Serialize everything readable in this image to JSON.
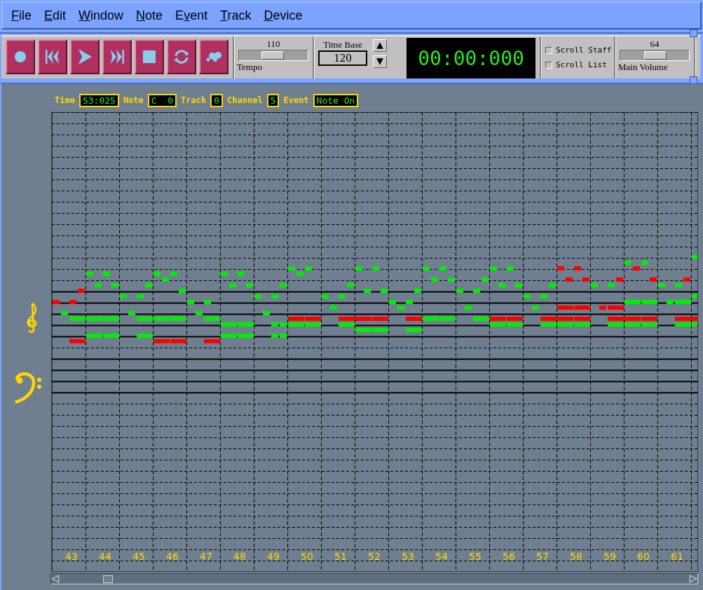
{
  "menu": [
    {
      "key": "F",
      "after": "ile"
    },
    {
      "key": "E",
      "after": "dit"
    },
    {
      "key": "W",
      "after": "indow"
    },
    {
      "key": "N",
      "after": "ote"
    },
    {
      "before": "E",
      "key": "v",
      "after": "ent"
    },
    {
      "key": "T",
      "after": "rack"
    },
    {
      "key": "D",
      "after": "evice"
    }
  ],
  "transport": [
    {
      "kind": "record"
    },
    {
      "kind": "rewind"
    },
    {
      "kind": "play"
    },
    {
      "kind": "forward"
    },
    {
      "kind": "stop"
    },
    {
      "kind": "loop"
    },
    {
      "kind": "bubbles"
    }
  ],
  "tempo": {
    "value": "110",
    "label": "Tempo",
    "level": 0.47
  },
  "time_base": {
    "label": "Time Base",
    "value": "120"
  },
  "clock": "00:00:000",
  "options": [
    {
      "label": "Scroll Staff",
      "checked": false
    },
    {
      "label": "Scroll List",
      "checked": false
    }
  ],
  "volume": {
    "value": "64",
    "label": "Main Volume",
    "level": 0.5
  },
  "status": [
    {
      "label": "Time",
      "value": "53:025"
    },
    {
      "label": "Note",
      "value": "C  0"
    },
    {
      "label": "Track",
      "value": "0"
    },
    {
      "label": "Channel",
      "value": "5"
    },
    {
      "label": "Event",
      "value": "Note On"
    }
  ],
  "bars": [
    "43",
    "44",
    "45",
    "46",
    "47",
    "48",
    "49",
    "50",
    "51",
    "52",
    "53",
    "54",
    "55",
    "56",
    "57",
    "58",
    "59",
    "60",
    "61"
  ]
}
